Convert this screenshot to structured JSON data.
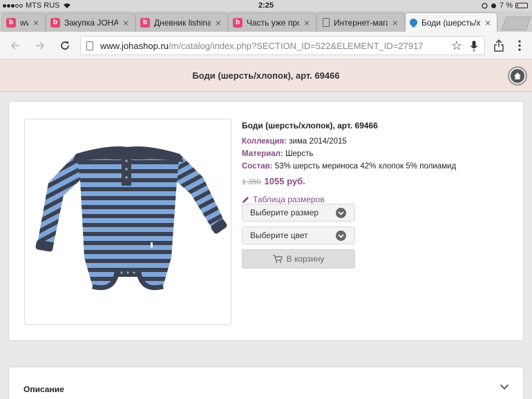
{
  "status": {
    "carrier": "MTS RUS",
    "time": "2:25",
    "battery": "7 %"
  },
  "tabs": [
    {
      "label": "www.h",
      "icon": "b-logo-icon",
      "active": false
    },
    {
      "label": "Закупка JOHA Ко",
      "icon": "b-logo-icon",
      "active": false
    },
    {
      "label": "Дневник lishina",
      "icon": "b-logo-icon",
      "active": false
    },
    {
      "label": "Часть уже прос",
      "icon": "b-logo-icon",
      "active": false
    },
    {
      "label": "Интернет-магази",
      "icon": "document-icon",
      "active": false
    },
    {
      "label": "Боди (шерсть/хло",
      "icon": "drop-icon",
      "active": true
    }
  ],
  "omnibox": {
    "host": "www.johashop.ru",
    "path": "/m/catalog/index.php?SECTION_ID=522&ELEMENT_ID=27917"
  },
  "header": {
    "title": "Боди (шерсть/хлопок), арт. 69466"
  },
  "product": {
    "title": "Боди (шерсть/хлопок), арт. 69466",
    "collection_label": "Коллекция:",
    "collection_value": "зима 2014/2015",
    "material_label": "Материал:",
    "material_value": "Шерсть",
    "composition_label": "Состав:",
    "composition_value": "53% шерсть мериноса 42% хлопок 5% полиамид",
    "old_price": "1 350",
    "new_price": "1055 руб.",
    "size_table_link": "Таблица размеров",
    "size_select": "Выберите размер",
    "color_select": "Выберите цвет",
    "cart_button": "В корзину"
  },
  "description": {
    "label": "Описание"
  },
  "colors": {
    "accent": "#8a4b85",
    "header_bg": "#f1e4df",
    "favicon": "#e3476f",
    "stripe_blue": "#7fa6d9",
    "stripe_navy": "#3a4152"
  }
}
